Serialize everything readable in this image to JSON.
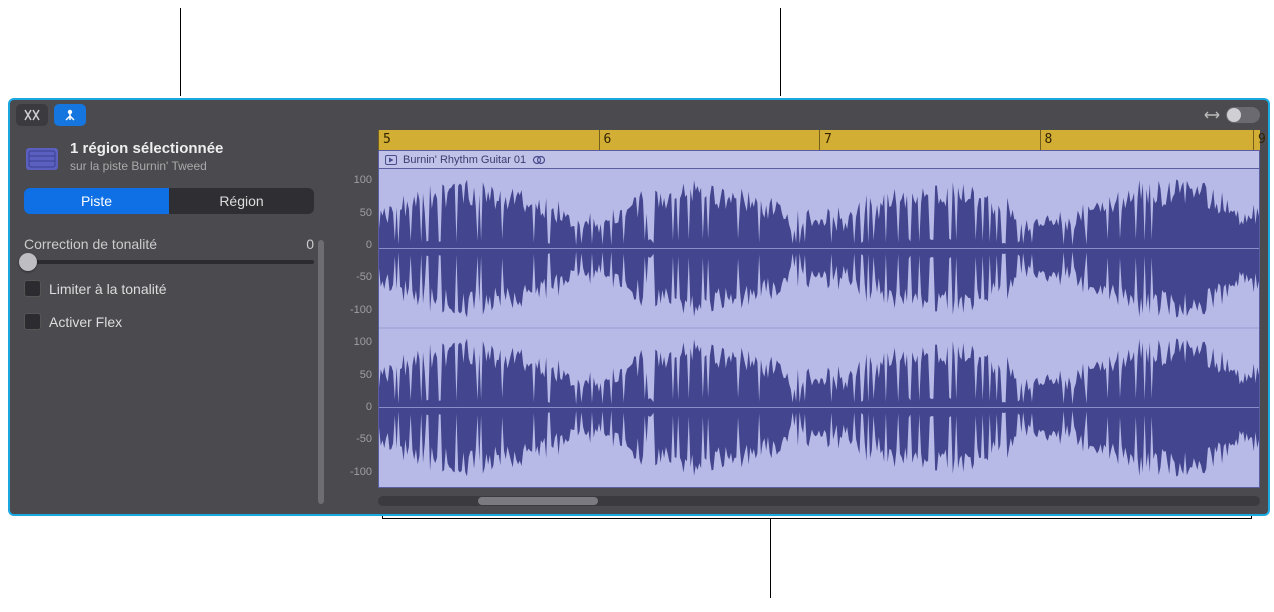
{
  "toolbar": {
    "edit_mode_icon": "scissors-intersect",
    "flex_icon": "flex-marker",
    "zoom_icon": "horizontal-arrows"
  },
  "inspector": {
    "title": "1 région sélectionnée",
    "subtitle": "sur la piste Burnin' Tweed",
    "tabs": {
      "track": "Piste",
      "region": "Région"
    },
    "pitch_label": "Correction de tonalité",
    "pitch_value": "0",
    "checkbox_limit": "Limiter à la tonalité",
    "checkbox_flex": "Activer Flex"
  },
  "ruler": {
    "bars": [
      "5",
      "6",
      "7",
      "8",
      "9"
    ]
  },
  "region": {
    "name": "Burnin' Rhythm Guitar 01"
  },
  "amp_scale": [
    "100",
    "50",
    "0",
    "-50",
    "-100",
    "100",
    "50",
    "0",
    "-50",
    "-100"
  ]
}
